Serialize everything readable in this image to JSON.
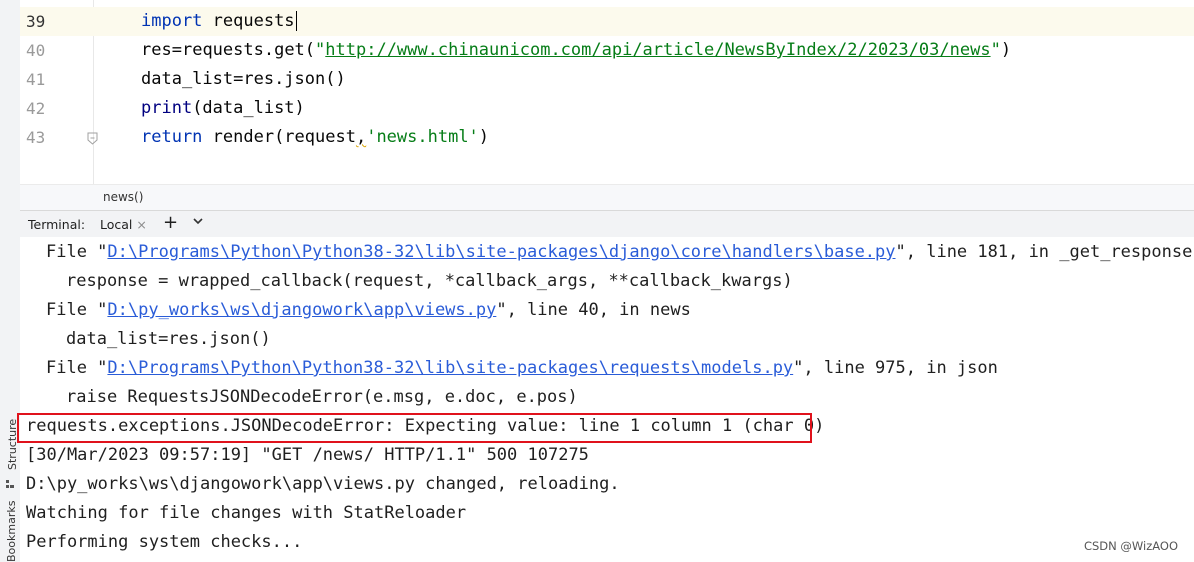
{
  "editor": {
    "lines": [
      {
        "number": "39",
        "tokens": [
          {
            "t": "import",
            "c": "kw"
          },
          {
            "t": " requests",
            "c": ""
          }
        ]
      },
      {
        "number": "40",
        "tokens": [
          {
            "t": "res",
            "c": ""
          },
          {
            "t": "=",
            "c": ""
          },
          {
            "t": "requests.get(",
            "c": ""
          },
          {
            "t": "\"",
            "c": "str"
          },
          {
            "t": "http://www.chinaunicom.com/api/article/NewsByIndex/2/2023/03/news",
            "c": "url"
          },
          {
            "t": "\"",
            "c": "str"
          },
          {
            "t": ")",
            "c": ""
          }
        ]
      },
      {
        "number": "41",
        "tokens": [
          {
            "t": "data_list",
            "c": ""
          },
          {
            "t": "=res.json()",
            "c": ""
          }
        ]
      },
      {
        "number": "42",
        "tokens": [
          {
            "t": "print",
            "c": "bi"
          },
          {
            "t": "(data_list)",
            "c": ""
          }
        ]
      },
      {
        "number": "43",
        "tokens": [
          {
            "t": "return",
            "c": "kw"
          },
          {
            "t": " render(request",
            "c": ""
          },
          {
            "t": ",",
            "c": "squig"
          },
          {
            "t": "'news.html'",
            "c": "str"
          },
          {
            "t": ")",
            "c": ""
          }
        ]
      }
    ]
  },
  "breadcrumb": {
    "text": "news()"
  },
  "terminal_bar": {
    "label": "Terminal:",
    "tab_label": "Local",
    "close_glyph": "×",
    "add_glyph": "+"
  },
  "terminal": {
    "lines": [
      {
        "indent": 1,
        "parts": [
          {
            "t": "File \""
          },
          {
            "t": "D:\\Programs\\Python\\Python38-32\\lib\\site-packages\\django\\core\\handlers\\base.py",
            "link": true
          },
          {
            "t": "\", line 181, in _get_response"
          }
        ]
      },
      {
        "indent": 2,
        "parts": [
          {
            "t": "response = wrapped_callback(request, *callback_args, **callback_kwargs)"
          }
        ]
      },
      {
        "indent": 1,
        "parts": [
          {
            "t": "File \""
          },
          {
            "t": "D:\\py_works\\ws\\djangowork\\app\\views.py",
            "link": true
          },
          {
            "t": "\", line 40, in news"
          }
        ]
      },
      {
        "indent": 2,
        "parts": [
          {
            "t": "data_list=res.json()"
          }
        ]
      },
      {
        "indent": 1,
        "parts": [
          {
            "t": "File \""
          },
          {
            "t": "D:\\Programs\\Python\\Python38-32\\lib\\site-packages\\requests\\models.py",
            "link": true
          },
          {
            "t": "\", line 975, in json"
          }
        ]
      },
      {
        "indent": 2,
        "parts": [
          {
            "t": "raise RequestsJSONDecodeError(e.msg, e.doc, e.pos)"
          }
        ]
      },
      {
        "indent": 0,
        "parts": [
          {
            "t": "requests.exceptions.JSONDecodeError: Expecting value: line 1 column 1 (char 0)"
          }
        ]
      },
      {
        "indent": 0,
        "parts": [
          {
            "t": "[30/Mar/2023 09:57:19] \"GET /news/ HTTP/1.1\" 500 107275"
          }
        ]
      },
      {
        "indent": 0,
        "parts": [
          {
            "t": "D:\\py_works\\ws\\djangowork\\app\\views.py changed, reloading."
          }
        ]
      },
      {
        "indent": 0,
        "parts": [
          {
            "t": "Watching for file changes with StatReloader"
          }
        ]
      },
      {
        "indent": 0,
        "parts": [
          {
            "t": "Performing system checks..."
          }
        ]
      }
    ]
  },
  "side_panels": {
    "structure": "Structure",
    "bookmarks": "Bookmarks"
  },
  "watermark": "CSDN @WizAOO",
  "colors": {
    "error_highlight": "#e0121c",
    "link": "#2a5cd8",
    "keyword": "#0033b3",
    "string": "#067d17"
  }
}
